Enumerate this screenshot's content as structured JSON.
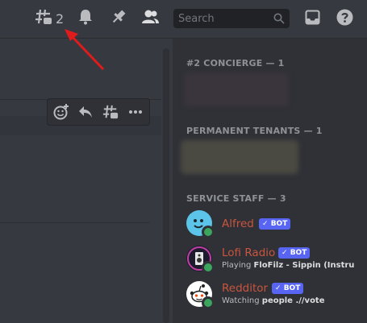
{
  "header": {
    "threads_count": "2",
    "search_placeholder": "Search",
    "icons": [
      "threads-icon",
      "bell-icon",
      "pin-icon",
      "members-icon",
      "search-icon",
      "inbox-icon",
      "help-icon"
    ]
  },
  "message_toolbar": {
    "icons": [
      "add-reaction-icon",
      "reply-icon",
      "create-thread-icon",
      "more-icon"
    ]
  },
  "members": {
    "sections": [
      {
        "label": "#2 CONCIERGE — 1"
      },
      {
        "label": "PERMANENT TENANTS — 1"
      },
      {
        "label": "SERVICE STAFF — 3"
      }
    ],
    "staff": [
      {
        "name": "Alfred",
        "badge": "BOT",
        "activity_prefix": "",
        "activity": ""
      },
      {
        "name": "Lofi Radio",
        "badge": "BOT",
        "activity_prefix": "Playing ",
        "activity": "FloFilz - Sippin (Instru"
      },
      {
        "name": "Redditor",
        "badge": "BOT",
        "activity_prefix": "Watching ",
        "activity": "people .//vote"
      }
    ]
  },
  "colors": {
    "bg": "#36393f",
    "sidebar": "#2f3136",
    "bot_badge": "#5865f2",
    "name_color": "#c9553e",
    "online": "#3ba55d",
    "arrow": "#e01b1b"
  }
}
